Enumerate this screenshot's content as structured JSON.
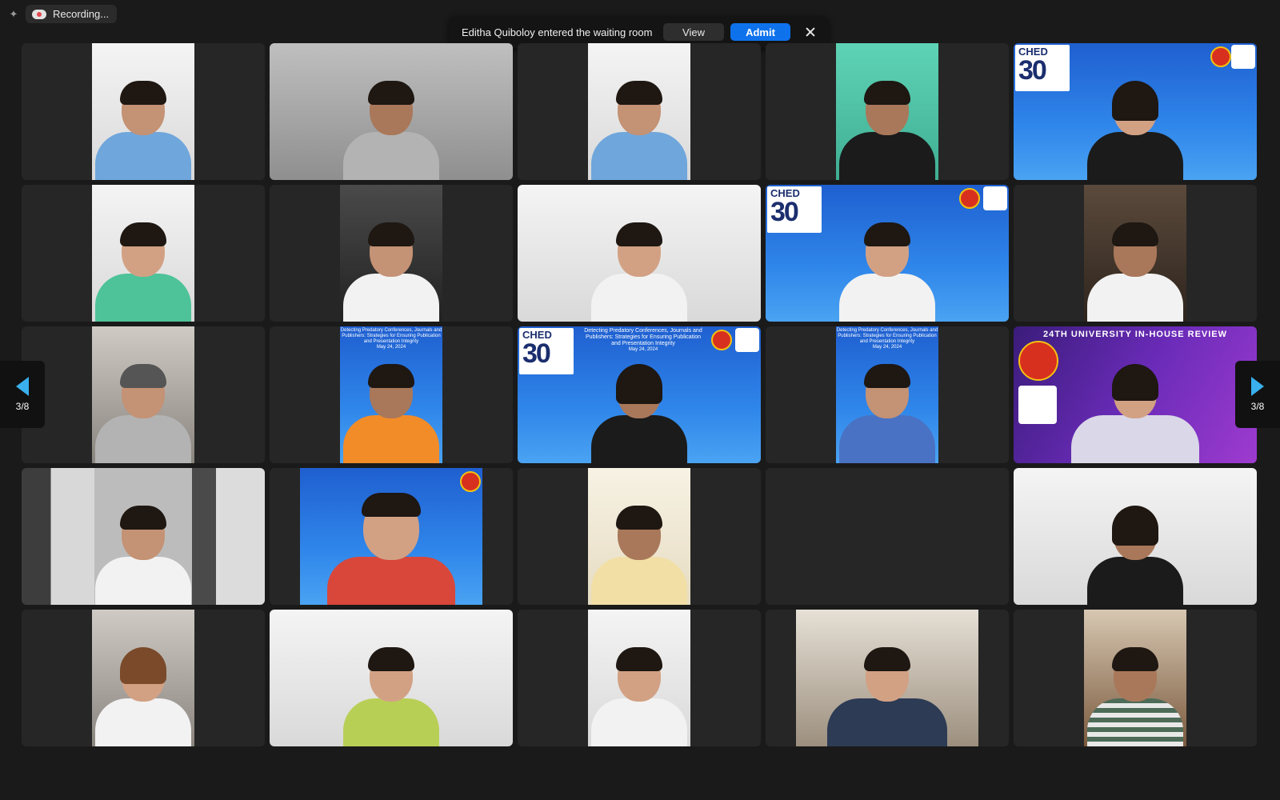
{
  "recording": {
    "label": "Recording..."
  },
  "notification": {
    "message": "Editha Quiboloy entered the waiting room",
    "view_label": "View",
    "admit_label": "Admit"
  },
  "pagination": {
    "left_label": "3/8",
    "right_label": "3/8"
  },
  "banners": {
    "ched": "CHED",
    "ched_30": "30",
    "webinar_title": "Detecting Predatory Conferences, Journals and Publishers: Strategies for Ensuring Publication and Presentation Integrity",
    "webinar_date": "May 24, 2024",
    "review_title": "24TH UNIVERSITY IN-HOUSE REVIEW"
  },
  "colors": {
    "admit_button": "#0e72ed",
    "nav_arrow": "#3ab0ee",
    "background": "#1a1a1a",
    "tile": "#262626"
  },
  "icons": [
    "sparkle-icon",
    "recording-cloud-icon",
    "close-icon",
    "arrow-left-icon",
    "arrow-right-icon"
  ]
}
